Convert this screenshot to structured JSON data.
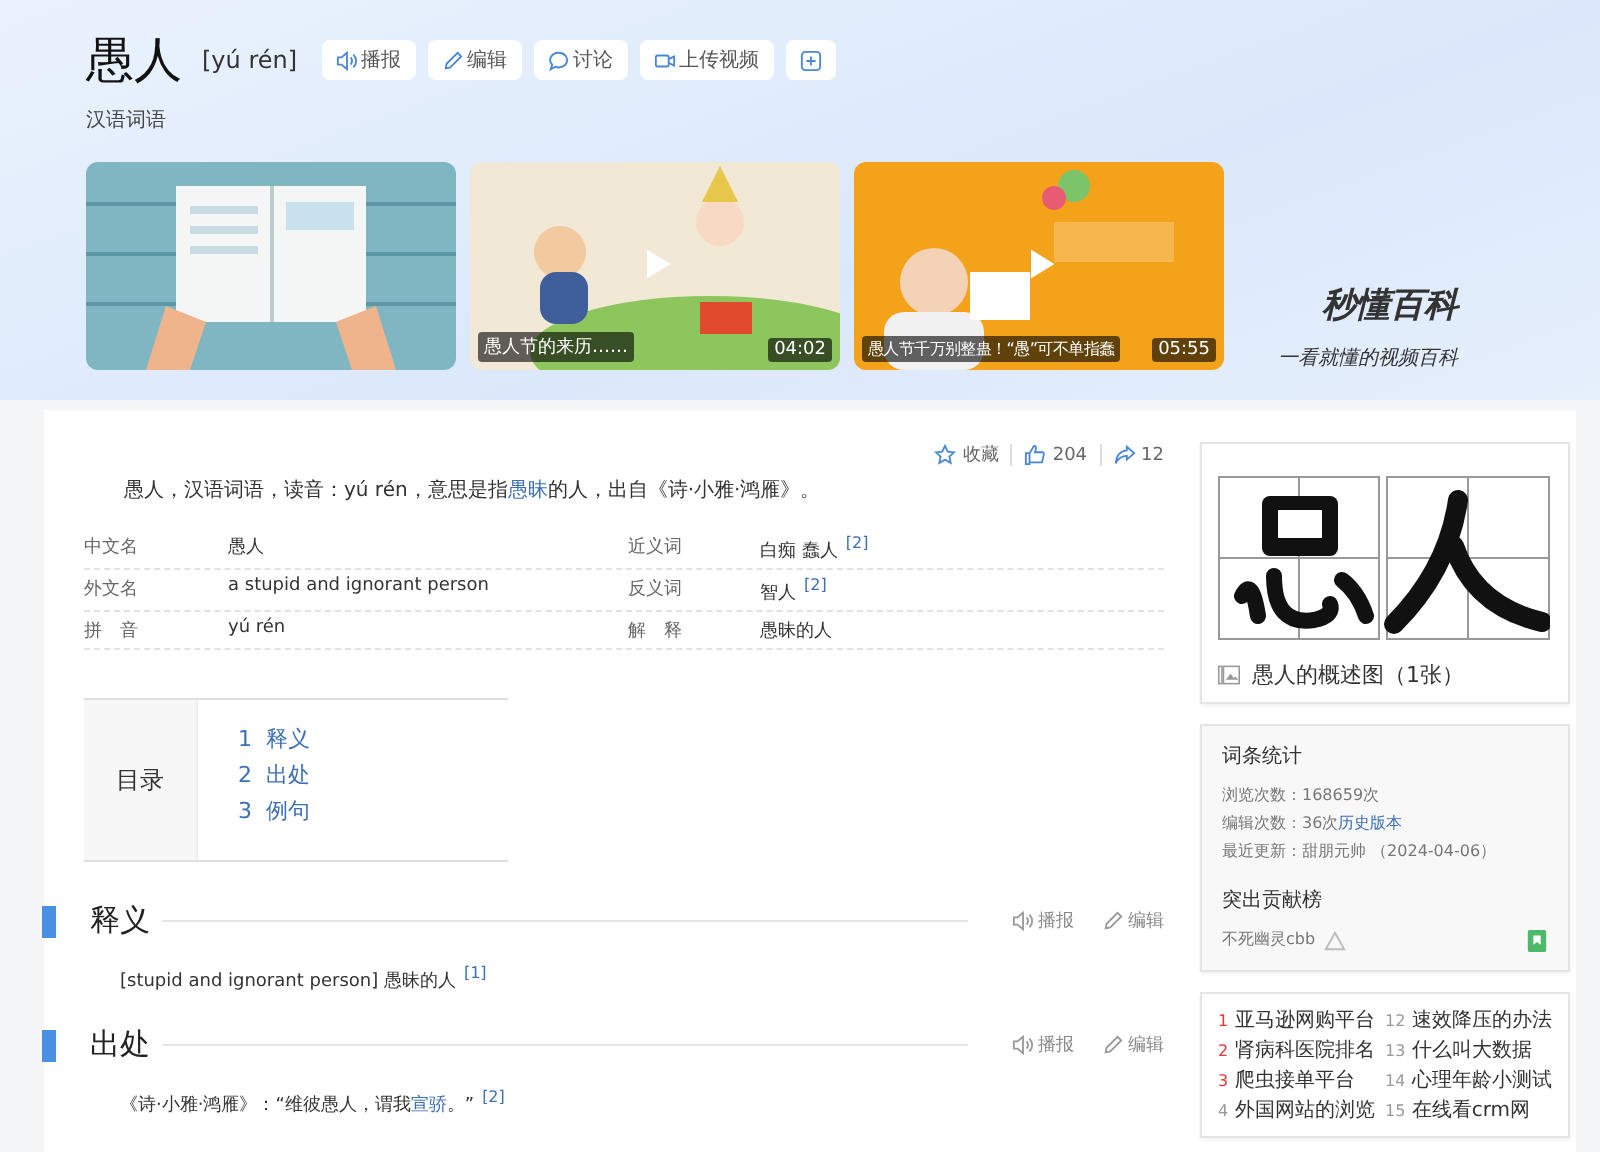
{
  "header": {
    "title": "愚人",
    "pinyin": "[yú rén]",
    "category": "汉语词语",
    "actions": [
      {
        "kind": "speak",
        "label": "播报"
      },
      {
        "kind": "edit",
        "label": "编辑"
      },
      {
        "kind": "discuss",
        "label": "讨论"
      },
      {
        "kind": "video",
        "label": "上传视频"
      },
      {
        "kind": "add"
      }
    ]
  },
  "videos": [
    {
      "kind": "book",
      "playable": false
    },
    {
      "kind": "clown",
      "playable": true,
      "caption": "愚人节的来历……",
      "duration": "04:02"
    },
    {
      "kind": "orange",
      "playable": true,
      "caption": "愚人节千万别整蛊！“愚”可不单指蠢",
      "duration": "05:55"
    }
  ],
  "brand": {
    "name": "秒懂百科",
    "slogan": "一看就懂的视频百科"
  },
  "toolbar": [
    {
      "kind": "favorite",
      "label": "收藏"
    },
    {
      "kind": "like",
      "label": "204"
    },
    {
      "kind": "share",
      "label": "12"
    }
  ],
  "summary": [
    {
      "kind": "text",
      "text": "愚人，汉语词语，读音：yú rén，意思是指"
    },
    {
      "kind": "link",
      "text": "愚昧"
    },
    {
      "kind": "text",
      "text": "的人，出自《诗·小雅·鸿雁》。"
    }
  ],
  "basic_info": [
    {
      "label": "中文名",
      "value": "愚人",
      "label_2": "近义词",
      "value_2": "白痴 蠢人",
      "ref_2": "[2]"
    },
    {
      "label": "外文名",
      "value": "a stupid and ignorant person",
      "label_2": "反义词",
      "value_2": "智人",
      "ref_2": "[2]"
    },
    {
      "label": "拼　音",
      "value": "yú rén",
      "label_2": "解　释",
      "value_2": "愚昧的人"
    }
  ],
  "toc": {
    "title": "目录",
    "items": [
      {
        "number": "1",
        "label": "释义"
      },
      {
        "number": "2",
        "label": "出处"
      },
      {
        "number": "3",
        "label": "例句"
      }
    ]
  },
  "sections": [
    {
      "title": "释义",
      "actions": [
        {
          "kind": "speak",
          "label": "播报"
        },
        {
          "kind": "edit",
          "label": "编辑"
        }
      ],
      "content": [
        {
          "kind": "text",
          "text": "[stupid and ignorant person] 愚昧的人"
        },
        {
          "kind": "ref",
          "text": "[1]"
        }
      ]
    },
    {
      "title": "出处",
      "actions": [
        {
          "kind": "speak",
          "label": "播报"
        },
        {
          "kind": "edit",
          "label": "编辑"
        }
      ],
      "content": [
        {
          "kind": "text",
          "text": "《诗·小雅·鸿雁》：“维彼愚人，谓我"
        },
        {
          "kind": "link",
          "text": "宣骄"
        },
        {
          "kind": "text",
          "text": "。”"
        },
        {
          "kind": "ref",
          "text": "[2]"
        }
      ]
    }
  ],
  "sidebar": {
    "image_caption": "愚人的概述图（1张）",
    "stats": {
      "title": "词条统计",
      "lines": [
        [
          {
            "kind": "text",
            "text": "浏览次数：168659次"
          }
        ],
        [
          {
            "kind": "text",
            "text": "编辑次数：36次"
          },
          {
            "kind": "link",
            "text": "历史版本"
          }
        ],
        [
          {
            "kind": "text",
            "text": "最近更新：甜朋元帅 （2024-04-06）"
          }
        ]
      ],
      "contributors_title": "突出贡献榜",
      "contributors": [
        {
          "name": "不死幽灵cbb"
        }
      ]
    },
    "hot_list": [
      {
        "number": "1",
        "label": "亚马逊网购平台",
        "hot": true
      },
      {
        "number": "12",
        "label": "速效降压的办法",
        "hot": false
      },
      {
        "number": "2",
        "label": "肾病科医院排名",
        "hot": true
      },
      {
        "number": "13",
        "label": "什么叫大数据",
        "hot": false
      },
      {
        "number": "3",
        "label": "爬虫接单平台",
        "hot": true
      },
      {
        "number": "14",
        "label": "心理年龄小测试",
        "hot": false
      },
      {
        "number": "4",
        "label": "外国网站的浏览",
        "hot": false
      },
      {
        "number": "15",
        "label": "在线看crm网",
        "hot": false
      }
    ]
  }
}
